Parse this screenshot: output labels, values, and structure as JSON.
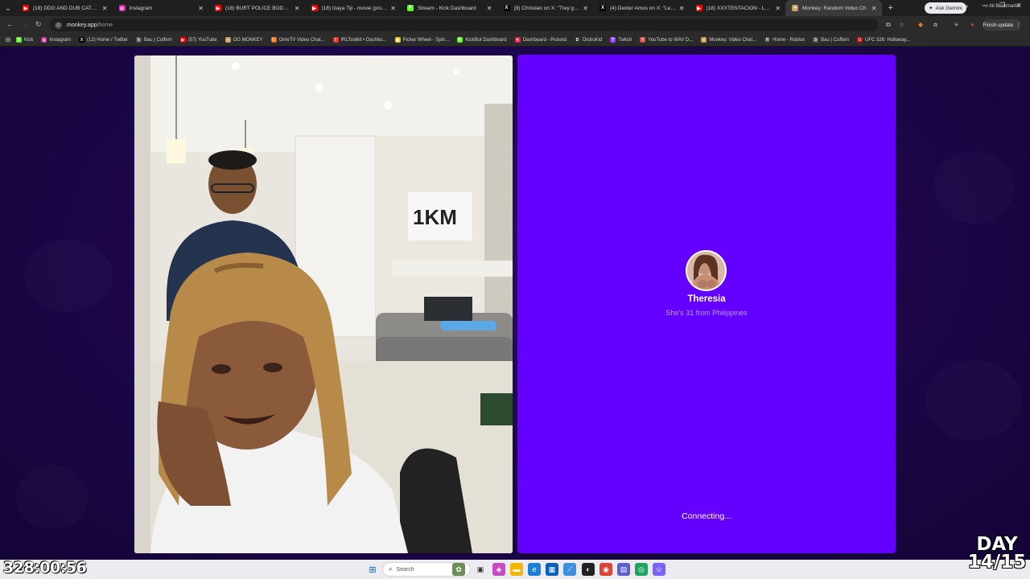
{
  "browser": {
    "tabs": [
      {
        "title": "(18) DDG AND DUB CATCH BIG",
        "fav": "▶",
        "color": "#ff0000"
      },
      {
        "title": "Instagram",
        "fav": "◎",
        "color": "#d6249f"
      },
      {
        "title": "(18) BURT POLICE BODYCAM",
        "fav": "▶",
        "color": "#ff0000"
      },
      {
        "title": "(18) Izaya Tiji - movie (prod sc",
        "fav": "▶",
        "color": "#ff0000"
      },
      {
        "title": "Stream - Kick Dashboard",
        "fav": "K",
        "color": "#53fc18"
      },
      {
        "title": "(8) Christian on X: \"Trey gets di",
        "fav": "X",
        "color": "#000000"
      },
      {
        "title": "(4) Dexter Amos on X: \"Leave t",
        "fav": "X",
        "color": "#000000"
      },
      {
        "title": "(18) XXXTENTACION - LOOK AT",
        "fav": "▶",
        "color": "#ff0000"
      },
      {
        "title": "Monkey: Random Video Ch",
        "fav": "●",
        "color": "#c8a060",
        "active": true
      }
    ],
    "ask_gemini": "Ask Gemini",
    "url_host": "monkey.app",
    "url_path": "/home",
    "finish_update": "Finish update",
    "bookmarks": [
      {
        "label": "Kick",
        "fav": "K",
        "color": "#53fc18"
      },
      {
        "label": "Instagram",
        "fav": "◎",
        "color": "#d6249f"
      },
      {
        "label": "(12) Home / Twitter",
        "fav": "X",
        "color": "#000000"
      },
      {
        "label": "Bau | Cuffem",
        "fav": "b",
        "color": "#555555"
      },
      {
        "label": "(57) YouTube",
        "fav": "▶",
        "color": "#ff0000"
      },
      {
        "label": "OG MONKEY",
        "fav": "●",
        "color": "#c8a060"
      },
      {
        "label": "OmeTV Video Chat...",
        "fav": "O",
        "color": "#ff6a00"
      },
      {
        "label": "IRLToolkit • Dashbo...",
        "fav": "I",
        "color": "#d83a3a"
      },
      {
        "label": "Picker Wheel - Spin...",
        "fav": "◉",
        "color": "#f2c200"
      },
      {
        "label": "KickBot Dashboard",
        "fav": "K",
        "color": "#53fc18"
      },
      {
        "label": "Dashboard - Pulsoid",
        "fav": "♥",
        "color": "#e03050"
      },
      {
        "label": "DistroKid",
        "fav": "D",
        "color": "#333333"
      },
      {
        "label": "Twitch",
        "fav": "T",
        "color": "#9146ff"
      },
      {
        "label": "YouTube to WAV D...",
        "fav": "Y",
        "color": "#e24b4b"
      },
      {
        "label": "Monkey: Video Chat...",
        "fav": "●",
        "color": "#c8a060"
      },
      {
        "label": "Home - Roblox",
        "fav": "R",
        "color": "#444444"
      },
      {
        "label": "Bau | Cuffem",
        "fav": "b",
        "color": "#555555"
      },
      {
        "label": "UFC 326: Holloway...",
        "fav": "U",
        "color": "#d20a0a"
      }
    ],
    "all_bookmarks": "All Bookmarks"
  },
  "match": {
    "name": "Theresia",
    "subtitle": "She's 31 from Philippines",
    "status": "Connecting..."
  },
  "overlay": {
    "timer": "328:00:56",
    "day_label": "DAY",
    "day_count": "14/15"
  },
  "taskbar": {
    "search_placeholder": "Search"
  },
  "colors": {
    "panel": "#6300ff",
    "page_bg": "#1c0648"
  }
}
